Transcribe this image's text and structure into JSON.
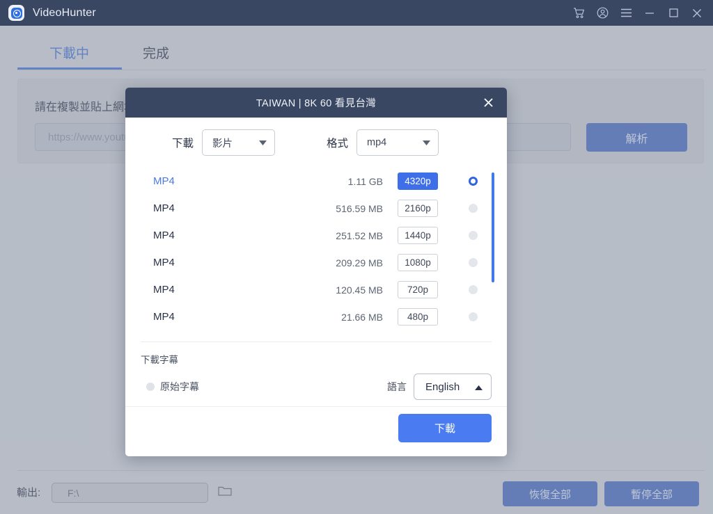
{
  "app": {
    "title": "VideoHunter",
    "logo_icon": "videohunter-logo-icon"
  },
  "window_controls": [
    {
      "name": "cart-icon",
      "glyph": "cart"
    },
    {
      "name": "account-icon",
      "glyph": "account"
    },
    {
      "name": "menu-icon",
      "glyph": "hamburger"
    },
    {
      "name": "minimize-icon",
      "glyph": "minimize"
    },
    {
      "name": "maximize-icon",
      "glyph": "maximize"
    },
    {
      "name": "close-icon",
      "glyph": "close"
    }
  ],
  "tabs": [
    {
      "label": "下載中",
      "active": true
    },
    {
      "label": "完成",
      "active": false
    }
  ],
  "url_card": {
    "instruction": "請在複製並貼上網址",
    "placeholder": "https://www.youtube.com/",
    "analyze_label": "解析"
  },
  "bottom_bar": {
    "output_label": "輸出:",
    "output_path": "F:\\",
    "folder_icon": "folder-icon",
    "resume_all_label": "恢復全部",
    "pause_all_label": "暫停全部"
  },
  "modal": {
    "title": "TAIWAN | 8K 60 看見台灣",
    "close_icon": "close-icon",
    "download_type": {
      "label": "下載",
      "value": "影片"
    },
    "format": {
      "label": "格式",
      "value": "mp4"
    },
    "rows": [
      {
        "format": "MP4",
        "size": "1.11 GB",
        "quality": "4320p",
        "selected": true
      },
      {
        "format": "MP4",
        "size": "516.59 MB",
        "quality": "2160p",
        "selected": false
      },
      {
        "format": "MP4",
        "size": "251.52 MB",
        "quality": "1440p",
        "selected": false
      },
      {
        "format": "MP4",
        "size": "209.29 MB",
        "quality": "1080p",
        "selected": false
      },
      {
        "format": "MP4",
        "size": "120.45 MB",
        "quality": "720p",
        "selected": false
      },
      {
        "format": "MP4",
        "size": "21.66 MB",
        "quality": "480p",
        "selected": false
      }
    ],
    "subtitles": {
      "section_label": "下載字幕",
      "option_label": "原始字幕",
      "option_selected": false,
      "language_label": "語言",
      "language_value": "English"
    },
    "download_button": "下載"
  },
  "colors": {
    "titlebar": "#3a4763",
    "accent_blue": "#3f6fe8",
    "button_blue": "#4067c0",
    "modal_bg": "#ffffff",
    "page_bg": "#cfd3d9"
  }
}
